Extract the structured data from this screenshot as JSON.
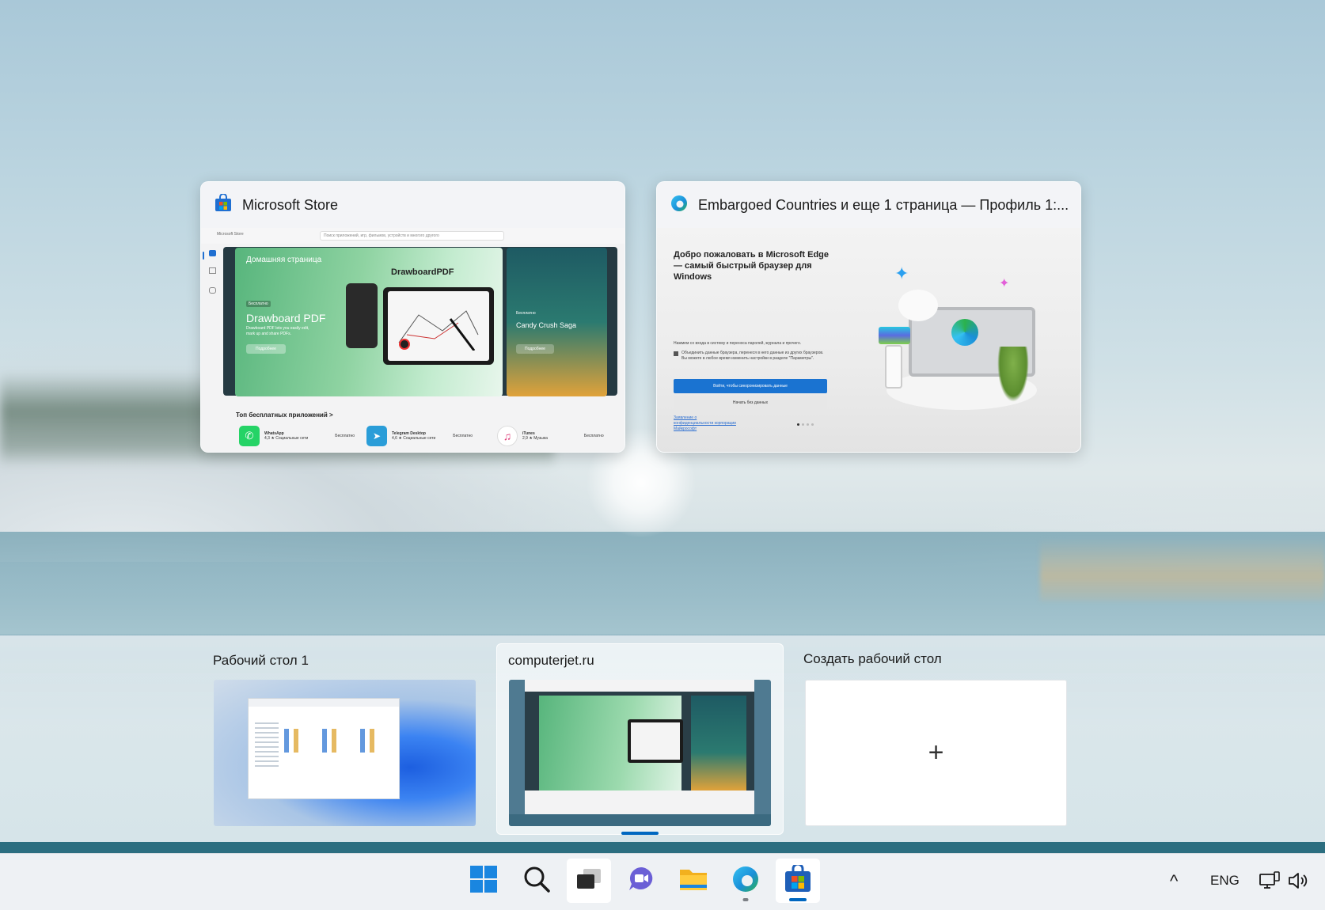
{
  "windows": [
    {
      "title": "Microsoft Store",
      "icon": "microsoft-store-icon"
    },
    {
      "title": "Embargoed Countries и еще 1 страница — Профиль 1:...",
      "icon": "edge-icon"
    }
  ],
  "store_thumb": {
    "window_title": "Microsoft Store",
    "search_placeholder": "Поиск приложений, игр, фильмов, устройств и многого другого",
    "hero_title": "Домашняя страница",
    "hero_badge": "Бесплатно",
    "hero_app": "Drawboard PDF",
    "hero_desc": "Drawboard PDF lets you easily edit, mark up and share PDFs.",
    "hero_button": "Подробнее",
    "hero_brand": "DrawboardPDF",
    "side_card_badge": "Бесплатно",
    "side_card_title": "Candy Crush Saga",
    "side_card_button": "Подробнее",
    "section_title": "Топ бесплатных приложений >",
    "apps": [
      {
        "name": "WhatsApp",
        "meta": "4,3 ★ Социальные сети",
        "price": "Бесплатно"
      },
      {
        "name": "Telegram Desktop",
        "meta": "4,6 ★ Социальные сети",
        "price": "Бесплатно"
      },
      {
        "name": "iTunes",
        "meta": "2,9 ★ Музыка",
        "price": "Бесплатно"
      }
    ]
  },
  "edge_thumb": {
    "heading": "Добро пожаловать в Microsoft Edge — самый быстрый браузер для Windows",
    "info": "Нажмем со входа в систему и переноса паролей, журнала и прочего.",
    "checkbox": "Объединить данные браузера, перенеся в него данные из других браузеров. Вы можете в любое время изменить настройки в разделе \"Параметры\".",
    "primary_button": "Войти, чтобы синхронизировать данные",
    "secondary_button": "Начать без данных",
    "link": "Заявление о конфиденциальности корпорации Майкрософт"
  },
  "desktops": [
    {
      "label": "Рабочий стол 1"
    },
    {
      "label": "computerjet.ru",
      "active": true
    },
    {
      "label": "Создать рабочий стол",
      "symbol": "+"
    }
  ],
  "taskbar": {
    "apps": [
      "start-icon",
      "search-icon",
      "task-view-icon",
      "chat-icon",
      "file-explorer-icon",
      "edge-icon",
      "microsoft-store-icon"
    ],
    "tray": {
      "chevron": "^",
      "language": "ENG"
    }
  },
  "colors": {
    "accent": "#0067c0",
    "taskbar": "#eef1f4",
    "desktop_stripe": "#2c6e80"
  }
}
